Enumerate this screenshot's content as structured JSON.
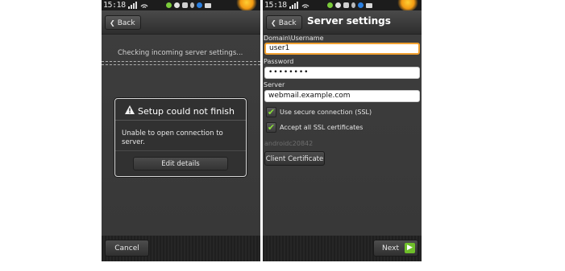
{
  "status_bar": {
    "time": "15:18",
    "network_label": "3G",
    "icons": [
      "signal-icon",
      "wifi-icon",
      "call-icon",
      "app-icon",
      "battery-icon",
      "usb-icon",
      "bluetooth-icon",
      "email-icon"
    ]
  },
  "left_screen": {
    "back_label": "Back",
    "progress_text": "Checking incoming server settings...",
    "dialog": {
      "title": "Setup could not finish",
      "message": "Unable to open connection to server.",
      "button_label": "Edit details"
    },
    "cancel_label": "Cancel"
  },
  "right_screen": {
    "back_label": "Back",
    "title": "Server settings",
    "username_label": "Domain\\Username",
    "username_value": "user1",
    "password_label": "Password",
    "password_value": "••••••••",
    "server_label": "Server",
    "server_value": "webmail.example.com",
    "secure_connection_label": "Use secure connection (SSL)",
    "secure_connection_checked": true,
    "accept_certs_label": "Accept all SSL certificates",
    "accept_certs_checked": true,
    "device_id": "androidc20842",
    "client_cert_label": "Client Certificate",
    "next_label": "Next"
  },
  "colors": {
    "accent_focus": "#f0a030",
    "check_green": "#8be03a",
    "next_arrow": "#6fbf2a"
  }
}
